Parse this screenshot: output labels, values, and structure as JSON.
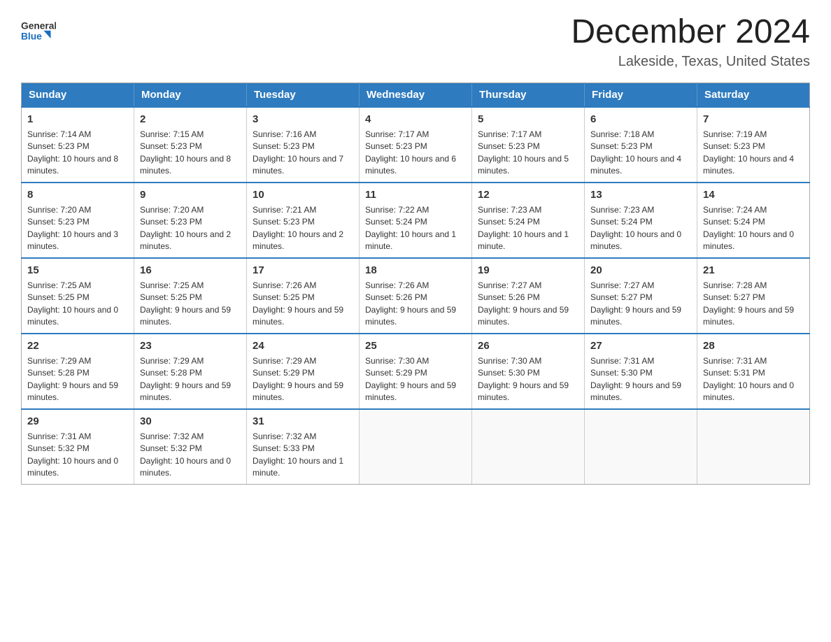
{
  "header": {
    "logo_general": "General",
    "logo_blue": "Blue",
    "month_year": "December 2024",
    "location": "Lakeside, Texas, United States"
  },
  "days_of_week": [
    "Sunday",
    "Monday",
    "Tuesday",
    "Wednesday",
    "Thursday",
    "Friday",
    "Saturday"
  ],
  "weeks": [
    [
      {
        "day": "1",
        "sunrise": "7:14 AM",
        "sunset": "5:23 PM",
        "daylight": "10 hours and 8 minutes."
      },
      {
        "day": "2",
        "sunrise": "7:15 AM",
        "sunset": "5:23 PM",
        "daylight": "10 hours and 8 minutes."
      },
      {
        "day": "3",
        "sunrise": "7:16 AM",
        "sunset": "5:23 PM",
        "daylight": "10 hours and 7 minutes."
      },
      {
        "day": "4",
        "sunrise": "7:17 AM",
        "sunset": "5:23 PM",
        "daylight": "10 hours and 6 minutes."
      },
      {
        "day": "5",
        "sunrise": "7:17 AM",
        "sunset": "5:23 PM",
        "daylight": "10 hours and 5 minutes."
      },
      {
        "day": "6",
        "sunrise": "7:18 AM",
        "sunset": "5:23 PM",
        "daylight": "10 hours and 4 minutes."
      },
      {
        "day": "7",
        "sunrise": "7:19 AM",
        "sunset": "5:23 PM",
        "daylight": "10 hours and 4 minutes."
      }
    ],
    [
      {
        "day": "8",
        "sunrise": "7:20 AM",
        "sunset": "5:23 PM",
        "daylight": "10 hours and 3 minutes."
      },
      {
        "day": "9",
        "sunrise": "7:20 AM",
        "sunset": "5:23 PM",
        "daylight": "10 hours and 2 minutes."
      },
      {
        "day": "10",
        "sunrise": "7:21 AM",
        "sunset": "5:23 PM",
        "daylight": "10 hours and 2 minutes."
      },
      {
        "day": "11",
        "sunrise": "7:22 AM",
        "sunset": "5:24 PM",
        "daylight": "10 hours and 1 minute."
      },
      {
        "day": "12",
        "sunrise": "7:23 AM",
        "sunset": "5:24 PM",
        "daylight": "10 hours and 1 minute."
      },
      {
        "day": "13",
        "sunrise": "7:23 AM",
        "sunset": "5:24 PM",
        "daylight": "10 hours and 0 minutes."
      },
      {
        "day": "14",
        "sunrise": "7:24 AM",
        "sunset": "5:24 PM",
        "daylight": "10 hours and 0 minutes."
      }
    ],
    [
      {
        "day": "15",
        "sunrise": "7:25 AM",
        "sunset": "5:25 PM",
        "daylight": "10 hours and 0 minutes."
      },
      {
        "day": "16",
        "sunrise": "7:25 AM",
        "sunset": "5:25 PM",
        "daylight": "9 hours and 59 minutes."
      },
      {
        "day": "17",
        "sunrise": "7:26 AM",
        "sunset": "5:25 PM",
        "daylight": "9 hours and 59 minutes."
      },
      {
        "day": "18",
        "sunrise": "7:26 AM",
        "sunset": "5:26 PM",
        "daylight": "9 hours and 59 minutes."
      },
      {
        "day": "19",
        "sunrise": "7:27 AM",
        "sunset": "5:26 PM",
        "daylight": "9 hours and 59 minutes."
      },
      {
        "day": "20",
        "sunrise": "7:27 AM",
        "sunset": "5:27 PM",
        "daylight": "9 hours and 59 minutes."
      },
      {
        "day": "21",
        "sunrise": "7:28 AM",
        "sunset": "5:27 PM",
        "daylight": "9 hours and 59 minutes."
      }
    ],
    [
      {
        "day": "22",
        "sunrise": "7:29 AM",
        "sunset": "5:28 PM",
        "daylight": "9 hours and 59 minutes."
      },
      {
        "day": "23",
        "sunrise": "7:29 AM",
        "sunset": "5:28 PM",
        "daylight": "9 hours and 59 minutes."
      },
      {
        "day": "24",
        "sunrise": "7:29 AM",
        "sunset": "5:29 PM",
        "daylight": "9 hours and 59 minutes."
      },
      {
        "day": "25",
        "sunrise": "7:30 AM",
        "sunset": "5:29 PM",
        "daylight": "9 hours and 59 minutes."
      },
      {
        "day": "26",
        "sunrise": "7:30 AM",
        "sunset": "5:30 PM",
        "daylight": "9 hours and 59 minutes."
      },
      {
        "day": "27",
        "sunrise": "7:31 AM",
        "sunset": "5:30 PM",
        "daylight": "9 hours and 59 minutes."
      },
      {
        "day": "28",
        "sunrise": "7:31 AM",
        "sunset": "5:31 PM",
        "daylight": "10 hours and 0 minutes."
      }
    ],
    [
      {
        "day": "29",
        "sunrise": "7:31 AM",
        "sunset": "5:32 PM",
        "daylight": "10 hours and 0 minutes."
      },
      {
        "day": "30",
        "sunrise": "7:32 AM",
        "sunset": "5:32 PM",
        "daylight": "10 hours and 0 minutes."
      },
      {
        "day": "31",
        "sunrise": "7:32 AM",
        "sunset": "5:33 PM",
        "daylight": "10 hours and 1 minute."
      },
      null,
      null,
      null,
      null
    ]
  ]
}
